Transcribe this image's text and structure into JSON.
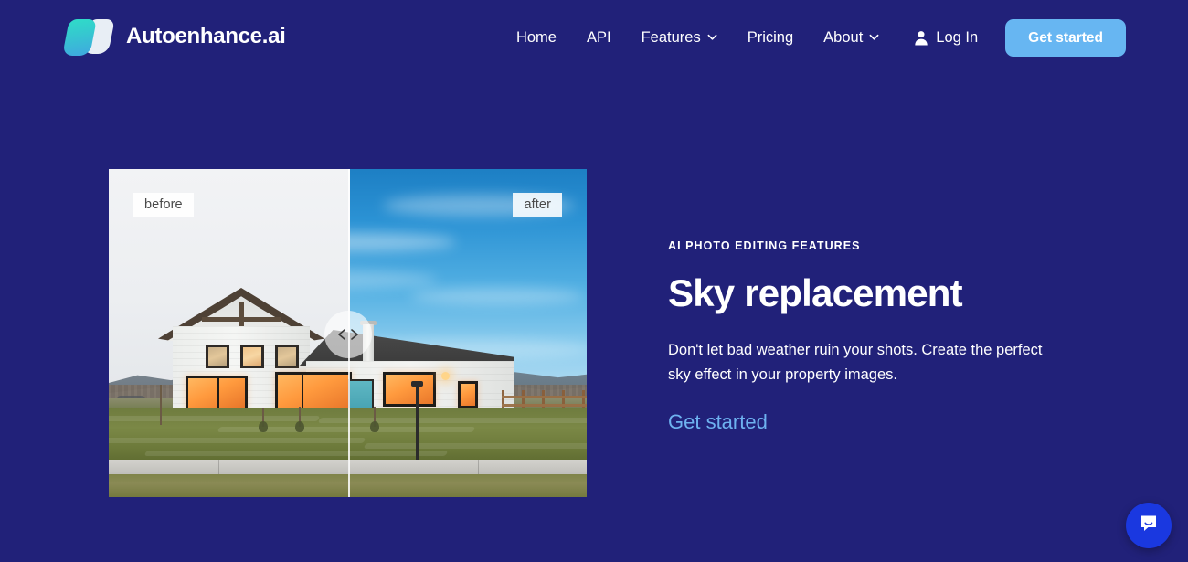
{
  "theme": {
    "background": "#212179",
    "accent_button": "#67b6f2",
    "link_blue": "#6eb2f0",
    "text_white": "#ffffff",
    "chat_blue": "#1a38e0"
  },
  "header": {
    "brand_name": "Autoenhance.ai",
    "logo_icon": "autoenhance-logo-icon",
    "nav": [
      {
        "label": "Home",
        "has_chevron": false
      },
      {
        "label": "API",
        "has_chevron": false
      },
      {
        "label": "Features",
        "has_chevron": true
      },
      {
        "label": "Pricing",
        "has_chevron": false
      },
      {
        "label": "About",
        "has_chevron": true
      }
    ],
    "login_label": "Log In",
    "login_icon": "person-icon",
    "cta_label": "Get started"
  },
  "hero": {
    "eyebrow": "AI PHOTO EDITING FEATURES",
    "title": "Sky replacement",
    "body": "Don't let bad weather ruin your shots. Create the perfect sky effect in your property images.",
    "link_label": "Get started"
  },
  "comparison": {
    "before_label": "before",
    "after_label": "after",
    "handle_icon": "left-right-chevrons-icon",
    "before_description": "Two-storey white farmhouse under a flat overcast white sky",
    "after_description": "Same farmhouse under a vivid blue sky with wispy clouds"
  },
  "chat": {
    "icon": "message-bubble-smile-icon",
    "label": "Open chat"
  }
}
